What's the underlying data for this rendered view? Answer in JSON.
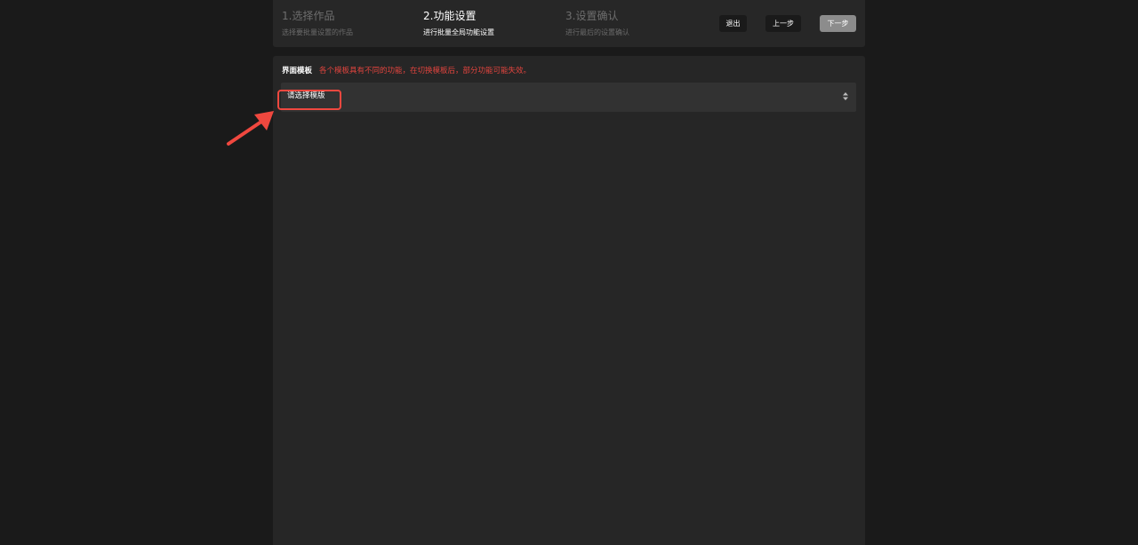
{
  "steps": [
    {
      "title": "1.选择作品",
      "desc": "选择要批量设置的作品",
      "state": "done"
    },
    {
      "title": "2.功能设置",
      "desc": "进行批量全局功能设置",
      "state": "active"
    },
    {
      "title": "3.设置确认",
      "desc": "进行最后的设置确认",
      "state": "todo"
    }
  ],
  "actions": {
    "exit_label": "退出",
    "prev_label": "上一步",
    "next_label": "下一步"
  },
  "template": {
    "label": "界面模板",
    "warning": "各个模板具有不同的功能，在切换模板后，部分功能可能失效。",
    "select_value": "请选择模版"
  },
  "colors": {
    "background": "#1a1a1a",
    "panel": "#262626",
    "warning": "#e0443e",
    "annotation": "#f0483f"
  }
}
